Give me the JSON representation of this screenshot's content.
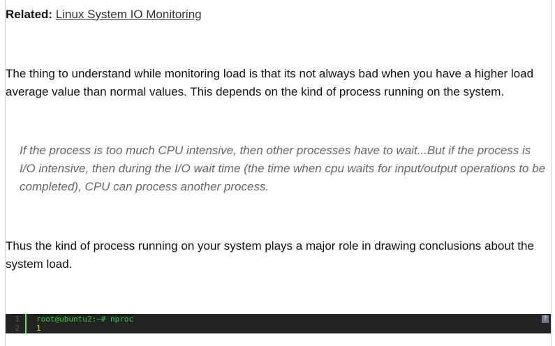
{
  "related": {
    "label": "Related:",
    "link_text": "Linux System IO Monitoring"
  },
  "paragraphs": [
    "The thing to understand while monitoring load is that its not always bad when you have a higher load average value than normal values. This depends on the kind of process running on the system.",
    "Thus the kind of process running on your system plays a major role in drawing conclusions about the system load."
  ],
  "quote": "If the process is too much CPU intensive, then other processes have to wait...But if the process is I/O intensive, then during the I/O wait time (the time when cpu waits for input/output operations to be completed), CPU can process another process.",
  "code_block": {
    "line_numbers": [
      "1",
      "2"
    ],
    "lines": [
      "root@ubuntu2:~# nproc",
      "1"
    ],
    "help_label": "?"
  },
  "colors": {
    "code_background": "#222222",
    "code_prompt": "#33cc33",
    "code_output": "#e0e000",
    "gutter_border": "#6ce26c",
    "quote_text": "#666666"
  }
}
